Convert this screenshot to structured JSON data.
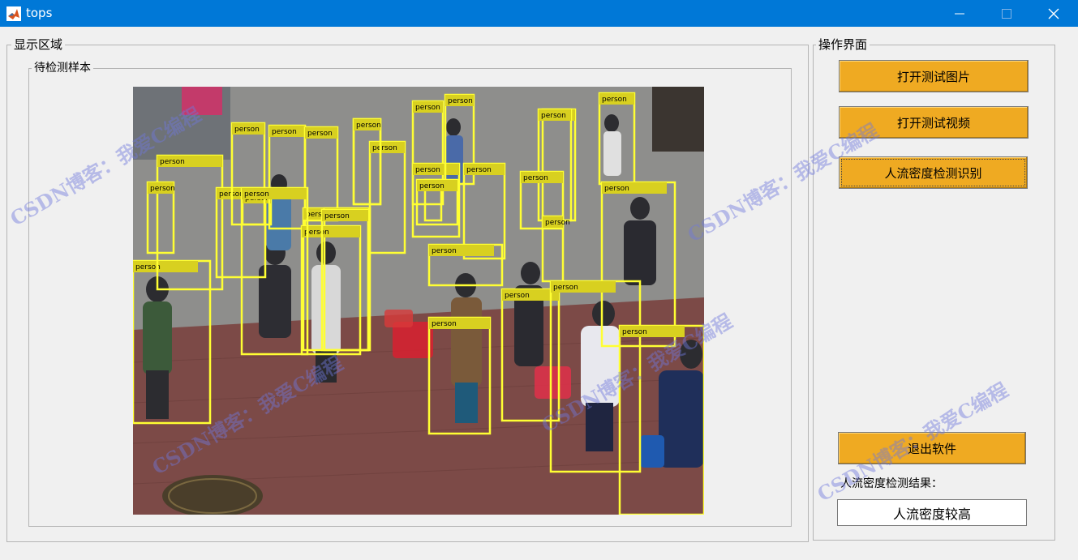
{
  "window": {
    "title": "tops",
    "icon": "matlab-icon",
    "titlebar_color": "#0078d7"
  },
  "display_panel": {
    "title": "显示区域",
    "sample_panel": {
      "title": "待检测样本"
    }
  },
  "detections": {
    "label": "person",
    "box_color": "#ffff33"
  },
  "operations_panel": {
    "title": "操作界面",
    "buttons": {
      "open_image": "打开测试图片",
      "open_video": "打开测试视频",
      "detect": "人流密度检测识别",
      "exit": "退出软件"
    },
    "button_color": "#efaa22",
    "result_label": "人流密度检测结果：",
    "result_value": "人流密度较高"
  },
  "watermark": {
    "text": "CSDN博客：我爱C编程"
  }
}
